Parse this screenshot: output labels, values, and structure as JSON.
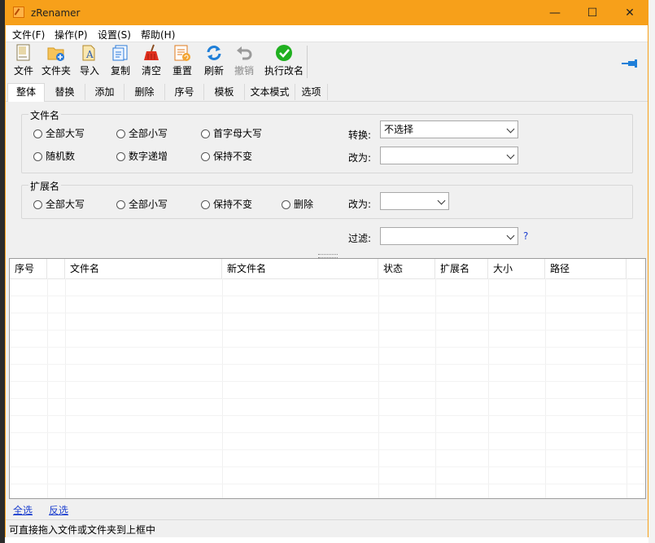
{
  "window": {
    "title": "zRenamer",
    "minimize": "—",
    "maximize": "☐",
    "close": "✕"
  },
  "menu": [
    {
      "label": "文件(F)"
    },
    {
      "label": "操作(P)"
    },
    {
      "label": "设置(S)"
    },
    {
      "label": "帮助(H)"
    }
  ],
  "toolbar": [
    {
      "label": "文件",
      "icon": "file-icon",
      "enabled": true
    },
    {
      "label": "文件夹",
      "icon": "folder-add-icon",
      "enabled": true
    },
    {
      "label": "导入",
      "icon": "import-icon",
      "enabled": true
    },
    {
      "label": "复制",
      "icon": "copy-icon",
      "enabled": true
    },
    {
      "label": "清空",
      "icon": "broom-icon",
      "enabled": true
    },
    {
      "label": "重置",
      "icon": "reset-icon",
      "enabled": true
    },
    {
      "label": "刷新",
      "icon": "refresh-icon",
      "enabled": true
    },
    {
      "label": "撤销",
      "icon": "undo-icon",
      "enabled": false
    },
    {
      "label": "执行改名",
      "icon": "execute-check-icon",
      "enabled": true
    }
  ],
  "tabs": [
    {
      "label": "整体",
      "active": true
    },
    {
      "label": "替换"
    },
    {
      "label": "添加"
    },
    {
      "label": "删除"
    },
    {
      "label": "序号"
    },
    {
      "label": "模板"
    },
    {
      "label": "文本模式"
    },
    {
      "label": "选项"
    }
  ],
  "filename_group": {
    "title": "文件名",
    "options": [
      "全部大写",
      "全部小写",
      "首字母大写",
      "随机数",
      "数字递增",
      "保持不变"
    ],
    "convert_label": "转换:",
    "convert_value": "不选择",
    "change_label": "改为:",
    "change_value": ""
  },
  "ext_group": {
    "title": "扩展名",
    "options": [
      "全部大写",
      "全部小写",
      "保持不变",
      "删除"
    ],
    "change_label": "改为:",
    "change_value": ""
  },
  "filter": {
    "label": "过滤:",
    "value": "",
    "help": "?"
  },
  "list": {
    "columns": [
      "序号",
      "",
      "文件名",
      "新文件名",
      "状态",
      "扩展名",
      "大小",
      "路径"
    ]
  },
  "links": {
    "select_all": "全选",
    "invert": "反选"
  },
  "status": "可直接拖入文件或文件夹到上框中",
  "colors": {
    "title_bar": "#f7a01a",
    "link": "#1c3fcf",
    "execute": "#20b020",
    "refresh": "#1f7fd8",
    "broom": "#e0301e"
  }
}
